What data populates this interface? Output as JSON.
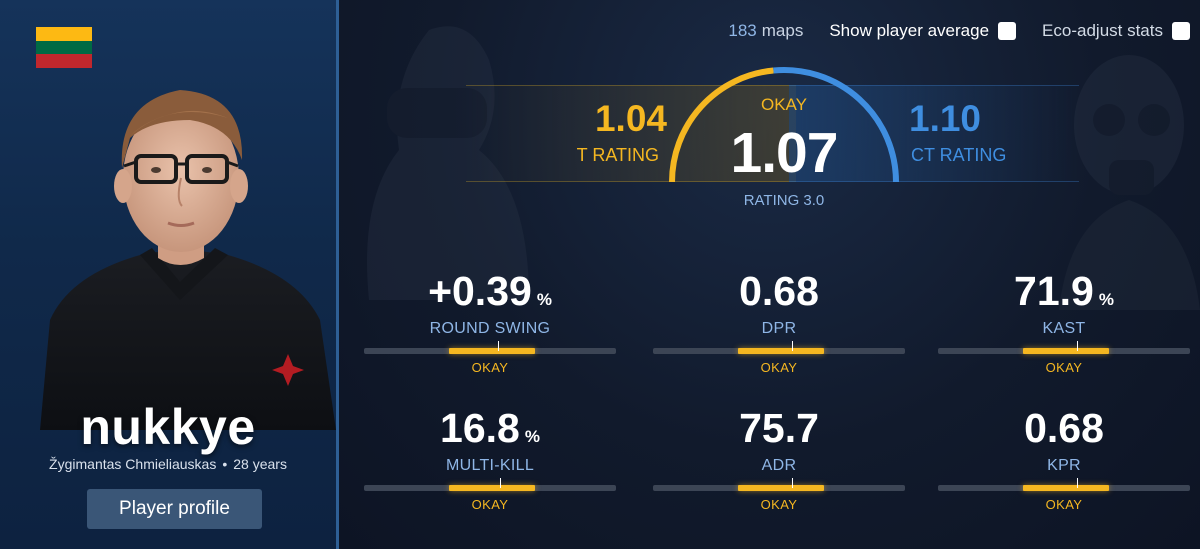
{
  "player": {
    "nickname": "nukkye",
    "real_name": "Žygimantas Chmieliauskas",
    "separator": "•",
    "age": "28 years",
    "profile_button": "Player profile",
    "flag_colors": [
      "#fdb913",
      "#006a44",
      "#c1272d"
    ]
  },
  "topbar": {
    "maps_count": "183",
    "maps_label": "maps",
    "show_average_label": "Show player average",
    "eco_adjust_label": "Eco-adjust stats"
  },
  "rating": {
    "t_value": "1.04",
    "t_label": "T RATING",
    "ct_value": "1.10",
    "ct_label": "CT RATING",
    "overall_verdict": "OKAY",
    "overall_value": "1.07",
    "overall_label": "RATING 3.0",
    "gauge_t_share": 0.47
  },
  "stats": [
    {
      "value": "+0.39",
      "unit": "%",
      "label": "ROUND SWING",
      "verdict": "OKAY",
      "marker": 0.53
    },
    {
      "value": "0.68",
      "unit": "",
      "label": "DPR",
      "verdict": "OKAY",
      "marker": 0.55
    },
    {
      "value": "71.9",
      "unit": "%",
      "label": "KAST",
      "verdict": "OKAY",
      "marker": 0.55
    },
    {
      "value": "16.8",
      "unit": "%",
      "label": "MULTI-KILL",
      "verdict": "OKAY",
      "marker": 0.54
    },
    {
      "value": "75.7",
      "unit": "",
      "label": "ADR",
      "verdict": "OKAY",
      "marker": 0.55
    },
    {
      "value": "0.68",
      "unit": "",
      "label": "KPR",
      "verdict": "OKAY",
      "marker": 0.55
    }
  ],
  "colors": {
    "t_side": "#f5b721",
    "ct_side": "#3f8ee0",
    "label_blue": "#8fb6e6",
    "bar_track": "#3c4555"
  }
}
